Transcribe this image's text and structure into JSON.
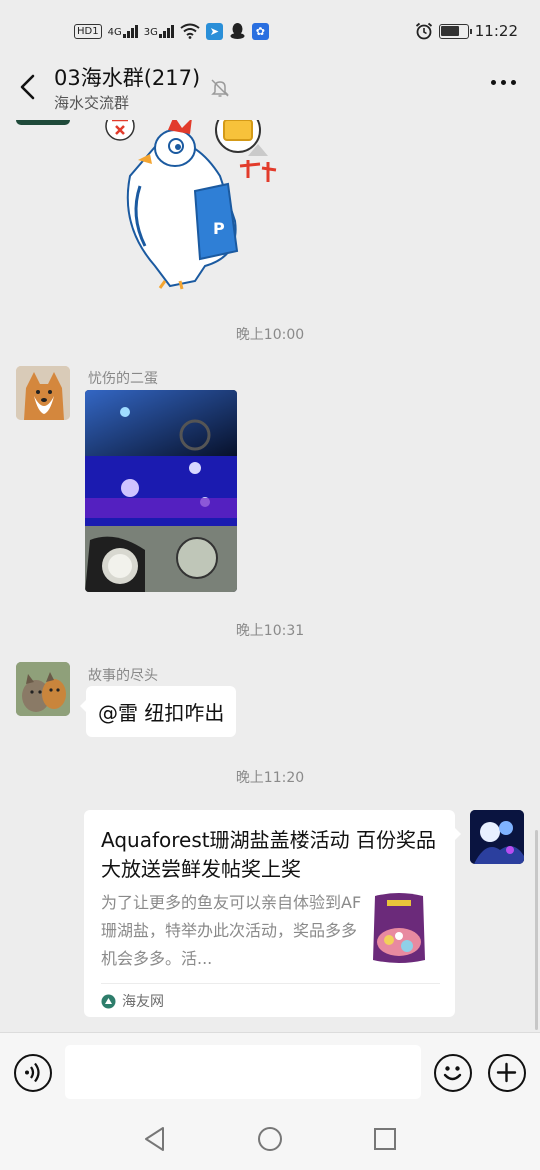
{
  "status_bar": {
    "hd_label": "HD",
    "hd_sub": "1",
    "net1": "4G",
    "net2": "3G",
    "time": "11:22",
    "battery_level": 0.72
  },
  "header": {
    "title": "03海水群(217)",
    "subtitle": "海水交流群"
  },
  "messages": [
    {
      "type": "sticker",
      "sender": "self-top-crop"
    },
    {
      "type": "time",
      "text": "晚上10:00"
    },
    {
      "type": "image",
      "sender": "忧伤的二蛋"
    },
    {
      "type": "time",
      "text": "晚上10:31"
    },
    {
      "type": "text",
      "sender": "故事的尽头",
      "text": "@雷  纽扣咋出"
    },
    {
      "type": "time",
      "text": "晚上11:20"
    },
    {
      "type": "link_card",
      "title": "Aquaforest珊湖盐盖楼活动 百份奖品大放送尝鲜发帖奖上奖",
      "description": "为了让更多的鱼友可以亲自体验到AF珊湖盐，特举办此次活动，奖品多多机会多多。活...",
      "source": "海友网"
    }
  ],
  "icons": {
    "back": "chevron-left-icon",
    "mute": "bell-off-icon",
    "more": "more-dots-icon",
    "voice": "voice-icon",
    "emoji": "emoji-icon",
    "plus": "plus-icon"
  },
  "colors": {
    "chat_background": "#ededed",
    "bubble_background": "#ffffff",
    "source_icon": "#2e7d6b"
  }
}
